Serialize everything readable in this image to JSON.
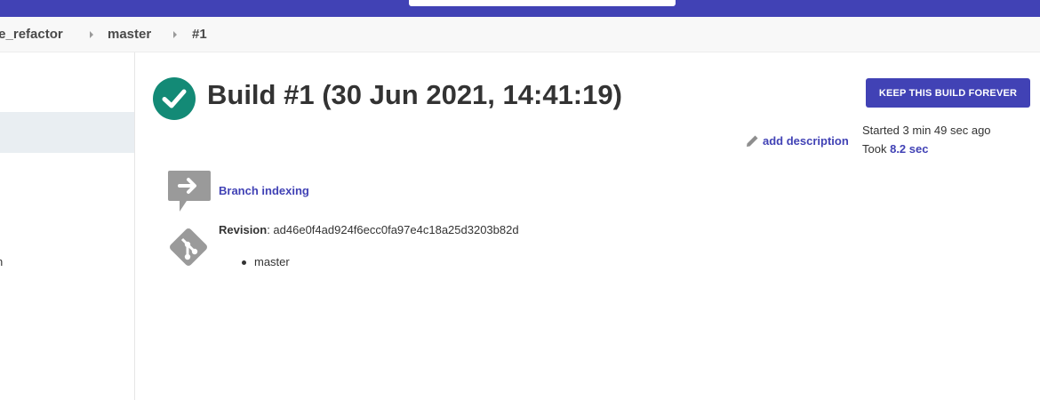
{
  "breadcrumbs": [
    {
      "label": "le_refactor"
    },
    {
      "label": "master"
    },
    {
      "label": "#1"
    }
  ],
  "sidebar": {
    "partial_item_text": "n"
  },
  "build": {
    "title": "Build #1 (30 Jun 2021, 14:41:19)",
    "status": "success",
    "status_color": "#138a76",
    "keep_button_label": "KEEP THIS BUILD FOREVER",
    "add_description_label": "add description",
    "started_text": "Started 3 min 49 sec ago",
    "took_prefix": "Took",
    "duration": "8.2 sec"
  },
  "cause": {
    "label": "Branch indexing",
    "icon": "arrow-in-speech-bubble-icon"
  },
  "scm": {
    "icon": "git-icon",
    "revision_label": "Revision",
    "revision_value": "ad46e0f4ad924f6ecc0fa97e4c18a25d3203b82d",
    "branches": [
      "master"
    ]
  },
  "colors": {
    "accent": "#4142b5",
    "success": "#138a76",
    "icon_gray": "#9a9a9a"
  }
}
